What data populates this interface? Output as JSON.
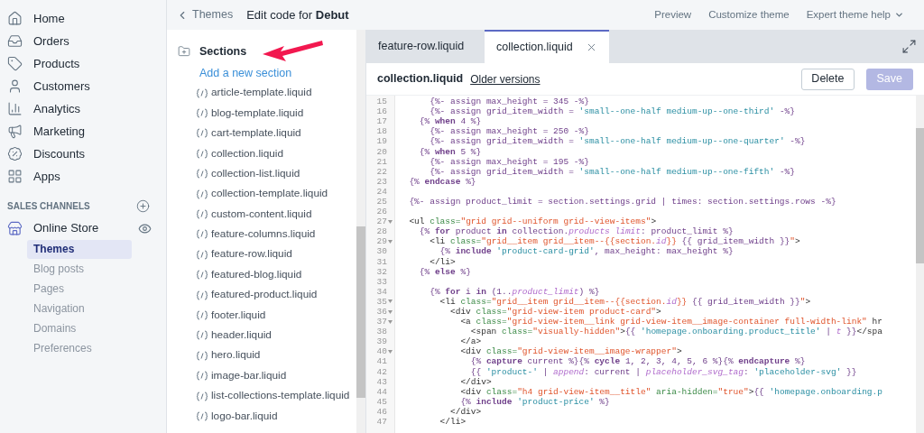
{
  "nav": [
    {
      "label": "Home"
    },
    {
      "label": "Orders"
    },
    {
      "label": "Products"
    },
    {
      "label": "Customers"
    },
    {
      "label": "Analytics"
    },
    {
      "label": "Marketing"
    },
    {
      "label": "Discounts"
    },
    {
      "label": "Apps"
    }
  ],
  "sales_channels": {
    "heading": "SALES CHANNELS",
    "channel": "Online Store",
    "subitems": [
      {
        "label": "Themes",
        "selected": true
      },
      {
        "label": "Blog posts",
        "selected": false
      },
      {
        "label": "Pages",
        "selected": false
      },
      {
        "label": "Navigation",
        "selected": false
      },
      {
        "label": "Domains",
        "selected": false
      },
      {
        "label": "Preferences",
        "selected": false
      }
    ]
  },
  "topbar": {
    "back": "Themes",
    "title": "Edit code for **Debut**",
    "links": [
      {
        "label": "Preview",
        "dropdown": false
      },
      {
        "label": "Customize theme",
        "dropdown": false
      },
      {
        "label": "Expert theme help",
        "dropdown": true
      }
    ]
  },
  "files": {
    "folder": "Sections",
    "add_link": "Add a new section",
    "items": [
      "article-template.liquid",
      "blog-template.liquid",
      "cart-template.liquid",
      "collection.liquid",
      "collection-list.liquid",
      "collection-template.liquid",
      "custom-content.liquid",
      "feature-columns.liquid",
      "feature-row.liquid",
      "featured-blog.liquid",
      "featured-product.liquid",
      "footer.liquid",
      "header.liquid",
      "hero.liquid",
      "image-bar.liquid",
      "list-collections-template.liquid",
      "logo-bar.liquid"
    ]
  },
  "tabs": [
    {
      "label": "feature-row.liquid",
      "selected": false,
      "closable": false
    },
    {
      "label": "collection.liquid",
      "selected": true,
      "closable": true
    }
  ],
  "editor": {
    "filename": "collection.liquid",
    "versions_link": "Older versions",
    "buttons": [
      {
        "label": "Delete",
        "disabled": false
      },
      {
        "label": "Save",
        "disabled": true
      }
    ],
    "lines": [
      {
        "number": "15",
        "fold": false,
        "tokens": [
          {
            "kind": "liquid",
            "text": "      {%- assign max_height = 345 -%}"
          }
        ]
      },
      {
        "number": "16",
        "fold": false,
        "tokens": [
          {
            "kind": "liquid",
            "text": "      {%- assign grid_item_width = "
          },
          {
            "kind": "str",
            "text": "'small--one-half medium-up--one-third'"
          },
          {
            "kind": "liquid",
            "text": " -%}"
          }
        ]
      },
      {
        "number": "17",
        "fold": false,
        "tokens": [
          {
            "kind": "liquid",
            "text": "    {% "
          },
          {
            "kind": "kw",
            "text": "when"
          },
          {
            "kind": "liquid",
            "text": " 4 %}"
          }
        ]
      },
      {
        "number": "18",
        "fold": false,
        "tokens": [
          {
            "kind": "liquid",
            "text": "      {%- assign max_height = 250 -%}"
          }
        ]
      },
      {
        "number": "19",
        "fold": false,
        "tokens": [
          {
            "kind": "liquid",
            "text": "      {%- assign grid_item_width = "
          },
          {
            "kind": "str",
            "text": "'small--one-half medium-up--one-quarter'"
          },
          {
            "kind": "liquid",
            "text": " -%}"
          }
        ]
      },
      {
        "number": "20",
        "fold": false,
        "tokens": [
          {
            "kind": "liquid",
            "text": "    {% "
          },
          {
            "kind": "kw",
            "text": "when"
          },
          {
            "kind": "liquid",
            "text": " 5 %}"
          }
        ]
      },
      {
        "number": "21",
        "fold": false,
        "tokens": [
          {
            "kind": "liquid",
            "text": "      {%- assign max_height = 195 -%}"
          }
        ]
      },
      {
        "number": "22",
        "fold": false,
        "tokens": [
          {
            "kind": "liquid",
            "text": "      {%- assign grid_item_width = "
          },
          {
            "kind": "str",
            "text": "'small--one-half medium-up--one-fifth'"
          },
          {
            "kind": "liquid",
            "text": " -%}"
          }
        ]
      },
      {
        "number": "23",
        "fold": false,
        "tokens": [
          {
            "kind": "liquid",
            "text": "  {% "
          },
          {
            "kind": "kw",
            "text": "endcase"
          },
          {
            "kind": "liquid",
            "text": " %}"
          }
        ]
      },
      {
        "number": "24",
        "fold": false
      },
      {
        "number": "25",
        "fold": false,
        "tokens": [
          {
            "kind": "liquid",
            "text": "  {%- assign product_limit = section.settings.grid | times: section.settings.rows -%}"
          }
        ]
      },
      {
        "number": "26",
        "fold": false
      },
      {
        "number": "27",
        "fold": true,
        "tokens": [
          {
            "kind": "plain",
            "text": "  <ul "
          },
          {
            "kind": "attr",
            "text": "class="
          },
          {
            "kind": "val",
            "text": "\"grid grid--uniform grid--view-items\""
          },
          {
            "kind": "plain",
            "text": ">"
          }
        ]
      },
      {
        "number": "28",
        "fold": false,
        "tokens": [
          {
            "kind": "liquid",
            "text": "    {% "
          },
          {
            "kind": "kw",
            "text": "for"
          },
          {
            "kind": "liquid",
            "text": " product "
          },
          {
            "kind": "kw",
            "text": "in"
          },
          {
            "kind": "liquid",
            "text": " collection."
          },
          {
            "kind": "em",
            "text": "products limit"
          },
          {
            "kind": "liquid",
            "text": ": product_limit %}"
          }
        ]
      },
      {
        "number": "29",
        "fold": true,
        "tokens": [
          {
            "kind": "plain",
            "text": "      <li "
          },
          {
            "kind": "attr",
            "text": "class="
          },
          {
            "kind": "val",
            "text": "\"grid__item grid__item--{{section."
          },
          {
            "kind": "em",
            "text": "id"
          },
          {
            "kind": "val",
            "text": "}} "
          },
          {
            "kind": "liquid",
            "text": "{{ grid_item_width }}"
          },
          {
            "kind": "val",
            "text": "\""
          },
          {
            "kind": "plain",
            "text": ">"
          }
        ]
      },
      {
        "number": "30",
        "fold": false,
        "tokens": [
          {
            "kind": "liquid",
            "text": "        {% "
          },
          {
            "kind": "kw",
            "text": "include "
          },
          {
            "kind": "str",
            "text": "'product-card-grid'"
          },
          {
            "kind": "liquid",
            "text": ", max_height: max_height %}"
          }
        ]
      },
      {
        "number": "31",
        "fold": false,
        "tokens": [
          {
            "kind": "plain",
            "text": "      </li>"
          }
        ]
      },
      {
        "number": "32",
        "fold": false,
        "tokens": [
          {
            "kind": "liquid",
            "text": "    {% "
          },
          {
            "kind": "kw",
            "text": "else"
          },
          {
            "kind": "liquid",
            "text": " %}"
          }
        ]
      },
      {
        "number": "33",
        "fold": false
      },
      {
        "number": "34",
        "fold": false,
        "tokens": [
          {
            "kind": "liquid",
            "text": "      {% "
          },
          {
            "kind": "kw",
            "text": "for"
          },
          {
            "kind": "liquid",
            "text": " i "
          },
          {
            "kind": "kw",
            "text": "in"
          },
          {
            "kind": "liquid",
            "text": " (1.."
          },
          {
            "kind": "em",
            "text": "product_limit"
          },
          {
            "kind": "liquid",
            "text": ") %}"
          }
        ]
      },
      {
        "number": "35",
        "fold": true,
        "tokens": [
          {
            "kind": "plain",
            "text": "        <li "
          },
          {
            "kind": "attr",
            "text": "class="
          },
          {
            "kind": "val",
            "text": "\"grid__item grid__item--{{section."
          },
          {
            "kind": "em",
            "text": "id"
          },
          {
            "kind": "val",
            "text": "}} "
          },
          {
            "kind": "liquid",
            "text": "{{ grid_item_width }}"
          },
          {
            "kind": "val",
            "text": "\""
          },
          {
            "kind": "plain",
            "text": ">"
          }
        ]
      },
      {
        "number": "36",
        "fold": true,
        "tokens": [
          {
            "kind": "plain",
            "text": "          <div "
          },
          {
            "kind": "attr",
            "text": "class="
          },
          {
            "kind": "val",
            "text": "\"grid-view-item product-card\""
          },
          {
            "kind": "plain",
            "text": ">"
          }
        ]
      },
      {
        "number": "37",
        "fold": true,
        "tokens": [
          {
            "kind": "plain",
            "text": "            <a "
          },
          {
            "kind": "attr",
            "text": "class="
          },
          {
            "kind": "val",
            "text": "\"grid-view-item__link grid-view-item__image-container full-width-link\""
          },
          {
            "kind": "plain",
            "text": " hr"
          }
        ]
      },
      {
        "number": "38",
        "fold": false,
        "tokens": [
          {
            "kind": "plain",
            "text": "              <span "
          },
          {
            "kind": "attr",
            "text": "class="
          },
          {
            "kind": "val",
            "text": "\"visually-hidden\""
          },
          {
            "kind": "plain",
            "text": ">"
          },
          {
            "kind": "liquid",
            "text": "{{ "
          },
          {
            "kind": "str",
            "text": "'homepage.onboarding.product_title'"
          },
          {
            "kind": "liquid",
            "text": " | "
          },
          {
            "kind": "em",
            "text": "t"
          },
          {
            "kind": "liquid",
            "text": " }}"
          },
          {
            "kind": "plain",
            "text": "</spa"
          }
        ]
      },
      {
        "number": "39",
        "fold": false,
        "tokens": [
          {
            "kind": "plain",
            "text": "            </a>"
          }
        ]
      },
      {
        "number": "40",
        "fold": true,
        "tokens": [
          {
            "kind": "plain",
            "text": "            <div "
          },
          {
            "kind": "attr",
            "text": "class="
          },
          {
            "kind": "val",
            "text": "\"grid-view-item__image-wrapper\""
          },
          {
            "kind": "plain",
            "text": ">"
          }
        ]
      },
      {
        "number": "41",
        "fold": false,
        "tokens": [
          {
            "kind": "liquid",
            "text": "              {% "
          },
          {
            "kind": "kw",
            "text": "capture"
          },
          {
            "kind": "liquid",
            "text": " current %}{% "
          },
          {
            "kind": "kw",
            "text": "cycle"
          },
          {
            "kind": "liquid",
            "text": " 1, 2, 3, 4, 5, 6 %}{% "
          },
          {
            "kind": "kw",
            "text": "endcapture"
          },
          {
            "kind": "liquid",
            "text": " %}"
          }
        ]
      },
      {
        "number": "42",
        "fold": false,
        "tokens": [
          {
            "kind": "liquid",
            "text": "              {{ "
          },
          {
            "kind": "str",
            "text": "'product-'"
          },
          {
            "kind": "liquid",
            "text": " | "
          },
          {
            "kind": "em",
            "text": "append"
          },
          {
            "kind": "liquid",
            "text": ": current | "
          },
          {
            "kind": "em",
            "text": "placeholder_svg_tag"
          },
          {
            "kind": "liquid",
            "text": ": "
          },
          {
            "kind": "str",
            "text": "'placeholder-svg'"
          },
          {
            "kind": "liquid",
            "text": " }}"
          }
        ]
      },
      {
        "number": "43",
        "fold": false,
        "tokens": [
          {
            "kind": "plain",
            "text": "            </div>"
          }
        ]
      },
      {
        "number": "44",
        "fold": false,
        "tokens": [
          {
            "kind": "plain",
            "text": "            <div "
          },
          {
            "kind": "attr",
            "text": "class="
          },
          {
            "kind": "val",
            "text": "\"h4 grid-view-item__title\""
          },
          {
            "kind": "attr",
            "text": " aria-hidden="
          },
          {
            "kind": "val",
            "text": "\"true\""
          },
          {
            "kind": "plain",
            "text": ">"
          },
          {
            "kind": "liquid",
            "text": "{{ "
          },
          {
            "kind": "str",
            "text": "'homepage.onboarding.p"
          }
        ]
      },
      {
        "number": "45",
        "fold": false,
        "tokens": [
          {
            "kind": "liquid",
            "text": "            {% "
          },
          {
            "kind": "kw",
            "text": "include "
          },
          {
            "kind": "str",
            "text": "'product-price'"
          },
          {
            "kind": "liquid",
            "text": " %}"
          }
        ]
      },
      {
        "number": "46",
        "fold": false,
        "tokens": [
          {
            "kind": "plain",
            "text": "          </div>"
          }
        ]
      },
      {
        "number": "47",
        "fold": false,
        "tokens": [
          {
            "kind": "plain",
            "text": "        </li>"
          }
        ]
      }
    ]
  }
}
